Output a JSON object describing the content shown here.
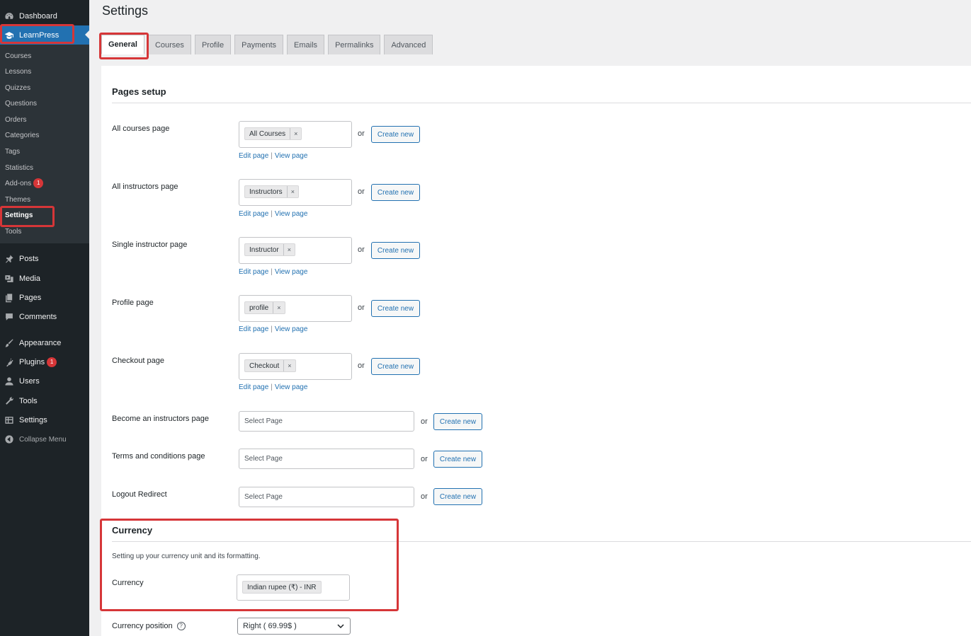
{
  "sidebar": {
    "dashboard": "Dashboard",
    "learnpress": "LearnPress",
    "submenu": [
      {
        "label": "Courses"
      },
      {
        "label": "Lessons"
      },
      {
        "label": "Quizzes"
      },
      {
        "label": "Questions"
      },
      {
        "label": "Orders"
      },
      {
        "label": "Categories"
      },
      {
        "label": "Tags"
      },
      {
        "label": "Statistics"
      },
      {
        "label": "Add-ons",
        "badge": "1"
      },
      {
        "label": "Themes"
      },
      {
        "label": "Settings"
      },
      {
        "label": "Tools"
      }
    ],
    "menu": [
      {
        "label": "Posts",
        "icon": "pin-icon"
      },
      {
        "label": "Media",
        "icon": "media-icon"
      },
      {
        "label": "Pages",
        "icon": "pages-icon"
      },
      {
        "label": "Comments",
        "icon": "comments-icon"
      },
      {
        "label": "Appearance",
        "icon": "brush-icon"
      },
      {
        "label": "Plugins",
        "icon": "plugin-icon",
        "badge": "1"
      },
      {
        "label": "Users",
        "icon": "user-icon"
      },
      {
        "label": "Tools",
        "icon": "wrench-icon"
      },
      {
        "label": "Settings",
        "icon": "settings-icon"
      },
      {
        "label": "Collapse Menu",
        "icon": "collapse-icon"
      }
    ]
  },
  "page": {
    "title": "Settings",
    "tabs": [
      "General",
      "Courses",
      "Profile",
      "Payments",
      "Emails",
      "Permalinks",
      "Advanced"
    ],
    "active_tab": "General"
  },
  "pages_setup": {
    "title": "Pages setup",
    "or_text": "or",
    "create_label": "Create new",
    "edit_label": "Edit page",
    "view_label": "View page",
    "sep": "|",
    "remove_symbol": "×",
    "rows": [
      {
        "label": "All courses page",
        "value": "All Courses"
      },
      {
        "label": "All instructors page",
        "value": "Instructors"
      },
      {
        "label": "Single instructor page",
        "value": "Instructor"
      },
      {
        "label": "Profile page",
        "value": "profile"
      },
      {
        "label": "Checkout page",
        "value": "Checkout"
      }
    ],
    "empty_rows": [
      {
        "label": "Become an instructors page",
        "placeholder": "Select Page"
      },
      {
        "label": "Terms and conditions page",
        "placeholder": "Select Page"
      },
      {
        "label": "Logout Redirect",
        "placeholder": "Select Page"
      }
    ]
  },
  "currency": {
    "title": "Currency",
    "description": "Setting up your currency unit and its formatting.",
    "label": "Currency",
    "value": "Indian rupee (₹) - INR",
    "position_label": "Currency position",
    "position_value": "Right ( 69.99$ )",
    "help_symbol": "?"
  },
  "colors": {
    "sidebar_bg": "#1d2327",
    "accent": "#2271b1",
    "highlight": "#d63638"
  }
}
